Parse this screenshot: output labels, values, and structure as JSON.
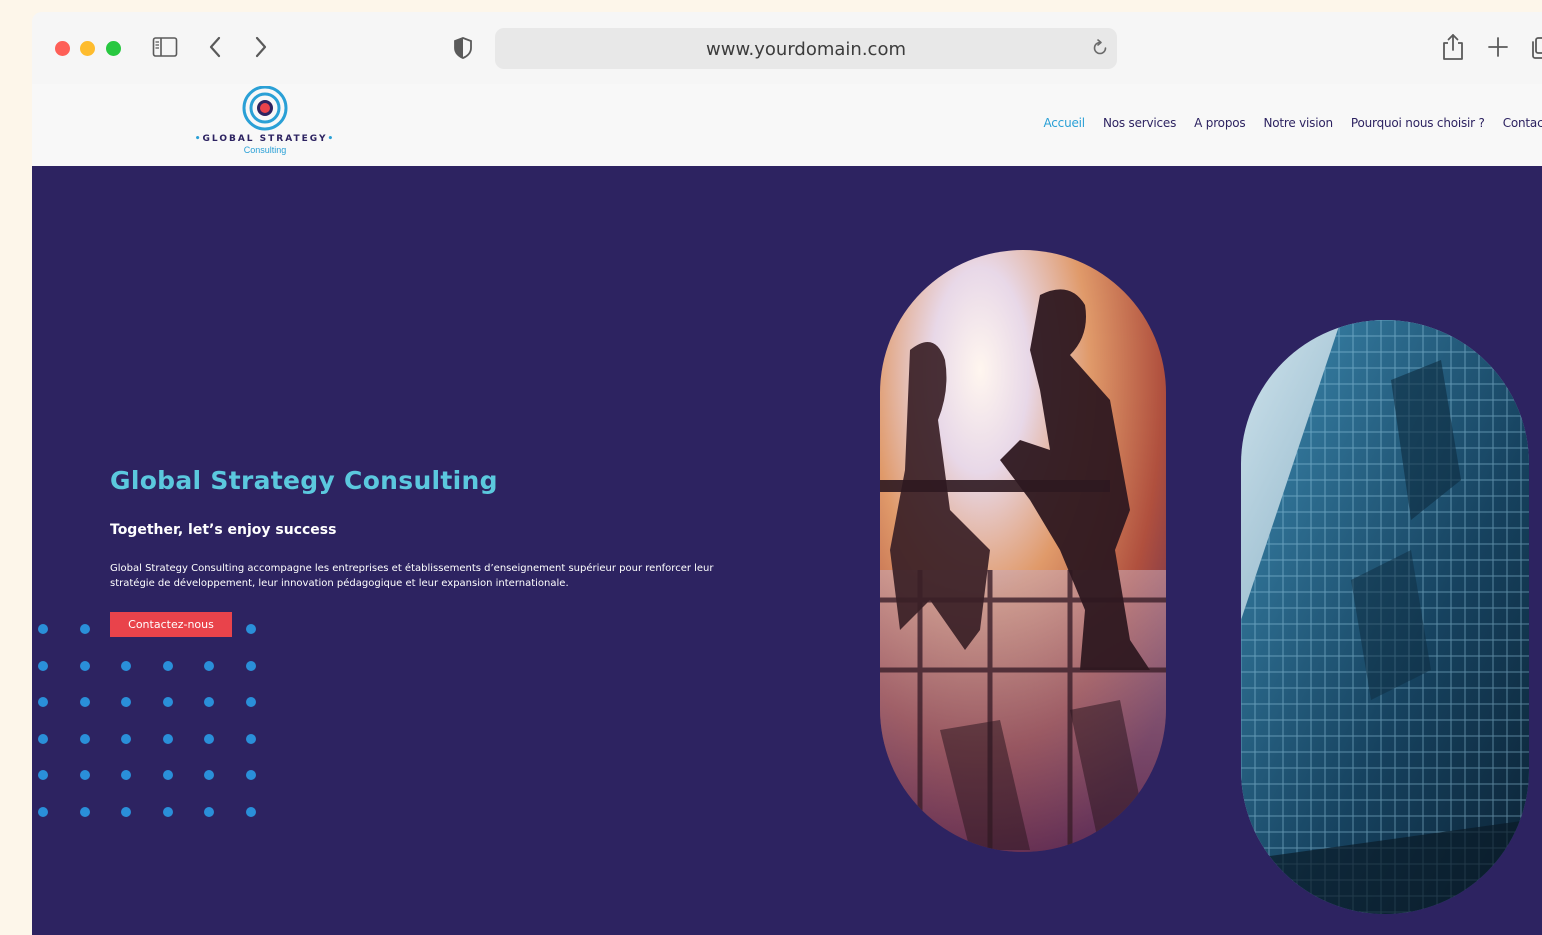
{
  "browser": {
    "url": "www.yourdomain.com"
  },
  "site": {
    "logo": {
      "title": "GLOBAL STRATEGY",
      "subtitle": "Consulting"
    },
    "nav": [
      {
        "label": "Accueil",
        "active": true
      },
      {
        "label": "Nos services",
        "active": false
      },
      {
        "label": "A propos",
        "active": false
      },
      {
        "label": "Notre vision",
        "active": false
      },
      {
        "label": "Pourquoi nous choisir ?",
        "active": false
      },
      {
        "label": "Contact",
        "active": false
      }
    ]
  },
  "hero": {
    "title": "Global Strategy Consulting",
    "tagline": "Together, let’s enjoy success",
    "description": "Global Strategy Consulting accompagne les entreprises et établissements d’enseignement supérieur pour renforcer leur stratégie de développement, leur innovation pédagogique et leur expansion internationale.",
    "cta_label": "Contactez-nous"
  },
  "colors": {
    "hero_bg": "#2d2361",
    "accent_cyan": "#5bc8de",
    "cta_red": "#e9434b",
    "dot_blue": "#2a8fd9",
    "nav_active": "#2aa0d6"
  },
  "icons": [
    "sidebar-icon",
    "back-icon",
    "forward-icon",
    "shield-icon",
    "reload-icon",
    "share-icon",
    "plus-icon",
    "tabs-icon"
  ]
}
